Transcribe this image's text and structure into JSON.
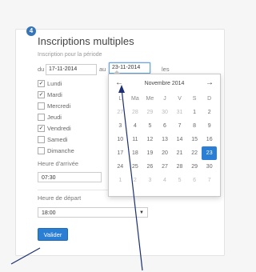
{
  "section": {
    "step_number": "4",
    "title": "Inscriptions multiples",
    "period_label": "Inscription pour la période"
  },
  "period": {
    "from_label": "du",
    "from_value": "17-11-2014",
    "to_label": "au",
    "to_value": "23-11-2014",
    "suffix": "les"
  },
  "days": [
    {
      "label": "Lundi",
      "checked": true
    },
    {
      "label": "Mardi",
      "checked": true
    },
    {
      "label": "Mercredi",
      "checked": false
    },
    {
      "label": "Jeudi",
      "checked": false
    },
    {
      "label": "Vendredi",
      "checked": true
    },
    {
      "label": "Samedi",
      "checked": false
    },
    {
      "label": "Dimanche",
      "checked": false
    }
  ],
  "arrival": {
    "label": "Heure d'arrivée",
    "value": "07:30"
  },
  "departure": {
    "label": "Heure de départ",
    "value": "18:00"
  },
  "submit_label": "Valider",
  "datepicker": {
    "month_label": "Novembre 2014",
    "prev_icon": "←",
    "next_icon": "→",
    "weekdays": [
      "L",
      "Ma",
      "Me",
      "J",
      "V",
      "S",
      "D"
    ],
    "weeks": [
      [
        {
          "d": "27",
          "m": true
        },
        {
          "d": "28",
          "m": true
        },
        {
          "d": "29",
          "m": true
        },
        {
          "d": "30",
          "m": true
        },
        {
          "d": "31",
          "m": true
        },
        {
          "d": "1",
          "m": false
        },
        {
          "d": "2",
          "m": false
        }
      ],
      [
        {
          "d": "3",
          "m": false
        },
        {
          "d": "4",
          "m": false
        },
        {
          "d": "5",
          "m": false
        },
        {
          "d": "6",
          "m": false
        },
        {
          "d": "7",
          "m": false
        },
        {
          "d": "8",
          "m": false
        },
        {
          "d": "9",
          "m": false
        }
      ],
      [
        {
          "d": "10",
          "m": false
        },
        {
          "d": "11",
          "m": false
        },
        {
          "d": "12",
          "m": false
        },
        {
          "d": "13",
          "m": false
        },
        {
          "d": "14",
          "m": false
        },
        {
          "d": "15",
          "m": false
        },
        {
          "d": "16",
          "m": false
        }
      ],
      [
        {
          "d": "17",
          "m": false
        },
        {
          "d": "18",
          "m": false
        },
        {
          "d": "19",
          "m": false
        },
        {
          "d": "20",
          "m": false
        },
        {
          "d": "21",
          "m": false
        },
        {
          "d": "22",
          "m": false
        },
        {
          "d": "23",
          "m": false,
          "selected": true
        }
      ],
      [
        {
          "d": "24",
          "m": false
        },
        {
          "d": "25",
          "m": false
        },
        {
          "d": "26",
          "m": false
        },
        {
          "d": "27",
          "m": false
        },
        {
          "d": "28",
          "m": false
        },
        {
          "d": "29",
          "m": false
        },
        {
          "d": "30",
          "m": false
        }
      ],
      [
        {
          "d": "1",
          "m": true
        },
        {
          "d": "2",
          "m": true
        },
        {
          "d": "3",
          "m": true
        },
        {
          "d": "4",
          "m": true
        },
        {
          "d": "5",
          "m": true
        },
        {
          "d": "6",
          "m": true
        },
        {
          "d": "7",
          "m": true
        }
      ]
    ]
  },
  "colors": {
    "accent": "#2a7fd4",
    "badge": "#3575b8"
  }
}
